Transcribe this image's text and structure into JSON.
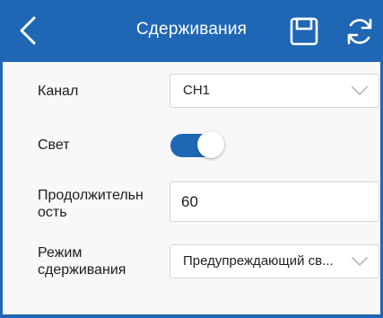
{
  "header": {
    "title": "Сдерживания"
  },
  "form": {
    "channel": {
      "label": "Канал",
      "value": "CH1"
    },
    "light": {
      "label": "Свет",
      "enabled": true
    },
    "duration": {
      "label_line1": "Продолжительн",
      "label_line2": "ость",
      "value": "60"
    },
    "mode": {
      "label_line1": "Режим",
      "label_line2": "сдерживания",
      "value": "Предупреждающий св..."
    }
  },
  "colors": {
    "accent": "#1f67b5",
    "background": "#f8f8f8",
    "chevron": "#bdbdbd"
  },
  "icons": {
    "back": "chevron-left-icon",
    "save": "save-icon",
    "refresh": "refresh-icon",
    "dropdown": "chevron-down-icon"
  }
}
